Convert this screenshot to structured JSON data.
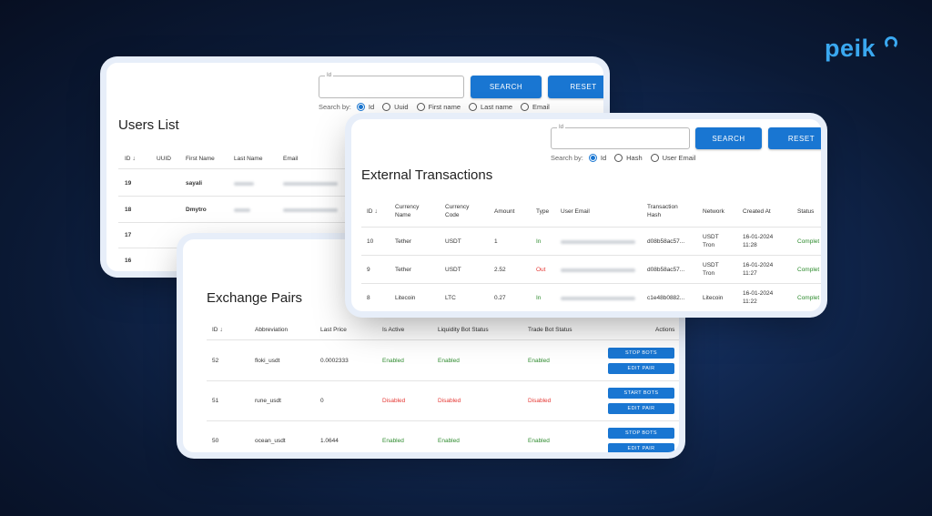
{
  "brand": {
    "logo_text": "peik"
  },
  "users_list": {
    "search_field_label": "Id",
    "search_button": "SEARCH",
    "reset_button": "RESET",
    "search_by_label": "Search by:",
    "search_by_options": [
      "Id",
      "Uuid",
      "First name",
      "Last name",
      "Email"
    ],
    "selected_option": "Id",
    "title": "Users List",
    "columns": [
      "ID",
      "UUID",
      "First Name",
      "Last Name",
      "Email"
    ],
    "rows": [
      {
        "id": "19",
        "first_name": "sayali"
      },
      {
        "id": "18",
        "first_name": "Dmytro"
      },
      {
        "id": "17",
        "first_name": ""
      },
      {
        "id": "16",
        "first_name": ""
      }
    ]
  },
  "external_transactions": {
    "search_field_label": "Id",
    "search_button": "SEARCH",
    "reset_button": "RESET",
    "search_by_label": "Search by:",
    "search_by_options": [
      "Id",
      "Hash",
      "User Email"
    ],
    "selected_option": "Id",
    "title": "External Transactions",
    "columns": {
      "id": "ID",
      "currency_name": "Currency Name",
      "currency_code": "Currency Code",
      "amount": "Amount",
      "type": "Type",
      "user_email": "User Email",
      "hash": "Transaction Hash",
      "network": "Network",
      "created_at": "Created At",
      "status": "Status"
    },
    "rows": [
      {
        "id": "10",
        "currency_name": "Tether",
        "currency_code": "USDT",
        "amount": "1",
        "type": "In",
        "hash": "d08b58ac57...",
        "network": "USDT Tron",
        "created_at": "16-01-2024 11:28",
        "status": "Complet"
      },
      {
        "id": "9",
        "currency_name": "Tether",
        "currency_code": "USDT",
        "amount": "2.52",
        "type": "Out",
        "hash": "d08b58ac57...",
        "network": "USDT Tron",
        "created_at": "16-01-2024 11:27",
        "status": "Complet"
      },
      {
        "id": "8",
        "currency_name": "Litecoin",
        "currency_code": "LTC",
        "amount": "0.27",
        "type": "In",
        "hash": "c1e48b0882...",
        "network": "Litecoin",
        "created_at": "16-01-2024 11:22",
        "status": "Complet"
      }
    ]
  },
  "exchange_pairs": {
    "title": "Exchange Pairs",
    "columns": {
      "id": "ID",
      "abbreviation": "Abbreviation",
      "last_price": "Last Price",
      "is_active": "Is Active",
      "liquidity": "Liquidity Bot Status",
      "trade": "Trade Bot Status",
      "actions": "Actions"
    },
    "rows": [
      {
        "id": "52",
        "abbreviation": "floki_usdt",
        "last_price": "0.0002333",
        "is_active": "Enabled",
        "liquidity": "Enabled",
        "trade": "Enabled",
        "bot_button": "STOP BOTS",
        "edit_button": "EDIT PAIR"
      },
      {
        "id": "51",
        "abbreviation": "rune_usdt",
        "last_price": "0",
        "is_active": "Disabled",
        "liquidity": "Disabled",
        "trade": "Disabled",
        "bot_button": "START BOTS",
        "edit_button": "EDIT PAIR"
      },
      {
        "id": "50",
        "abbreviation": "ocean_usdt",
        "last_price": "1.0644",
        "is_active": "Enabled",
        "liquidity": "Enabled",
        "trade": "Enabled",
        "bot_button": "STOP BOTS",
        "edit_button": "EDIT PAIR"
      }
    ]
  },
  "colors": {
    "accent": "#1976d2",
    "enabled": "#2e8b2e",
    "disabled": "#e53935",
    "logo": "#3aa8f0"
  }
}
